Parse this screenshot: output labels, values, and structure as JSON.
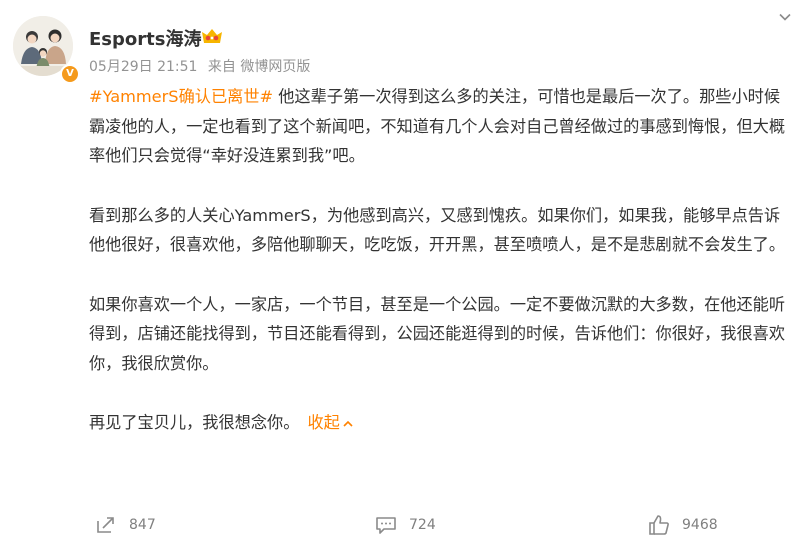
{
  "post": {
    "author": "Esports海涛",
    "time": "05月29日 21:51",
    "source": "来自 微博网页版",
    "verified_badge_icon": "v-badge-icon",
    "paragraphs": [
      {
        "topic": "#YammerS确认已离世#",
        "text": " 他这辈子第一次得到这么多的关注，可惜也是最后一次了。那些小时候霸凌他的人，一定也看到了这个新闻吧，不知道有几个人会对自己曾经做过的事感到悔恨，但大概率他们只会觉得“幸好没连累到我”吧。"
      },
      {
        "text": "看到那么多的人关心YammerS，为他感到高兴，又感到愧疚。如果你们，如果我，能够早点告诉他他很好，很喜欢他，多陪他聊聊天，吃吃饭，开开黑，甚至喷喷人，是不是悲剧就不会发生了。"
      },
      {
        "text": "如果你喜欢一个人，一家店，一个节目，甚至是一个公园。一定不要做沉默的大多数，在他还能听得到，店铺还能找得到，节目还能看得到，公园还能逛得到的时候，告诉他们：你很好，我很喜欢你，我很欣赏你。"
      },
      {
        "text": "再见了宝贝儿，我很想念你。",
        "collapse_label": "收起"
      }
    ]
  },
  "actions": {
    "repost_count": "847",
    "comment_count": "724",
    "like_count": "9468"
  },
  "colors": {
    "accent": "#ff8200",
    "meta": "#939393",
    "text": "#333333",
    "action": "#808080"
  }
}
